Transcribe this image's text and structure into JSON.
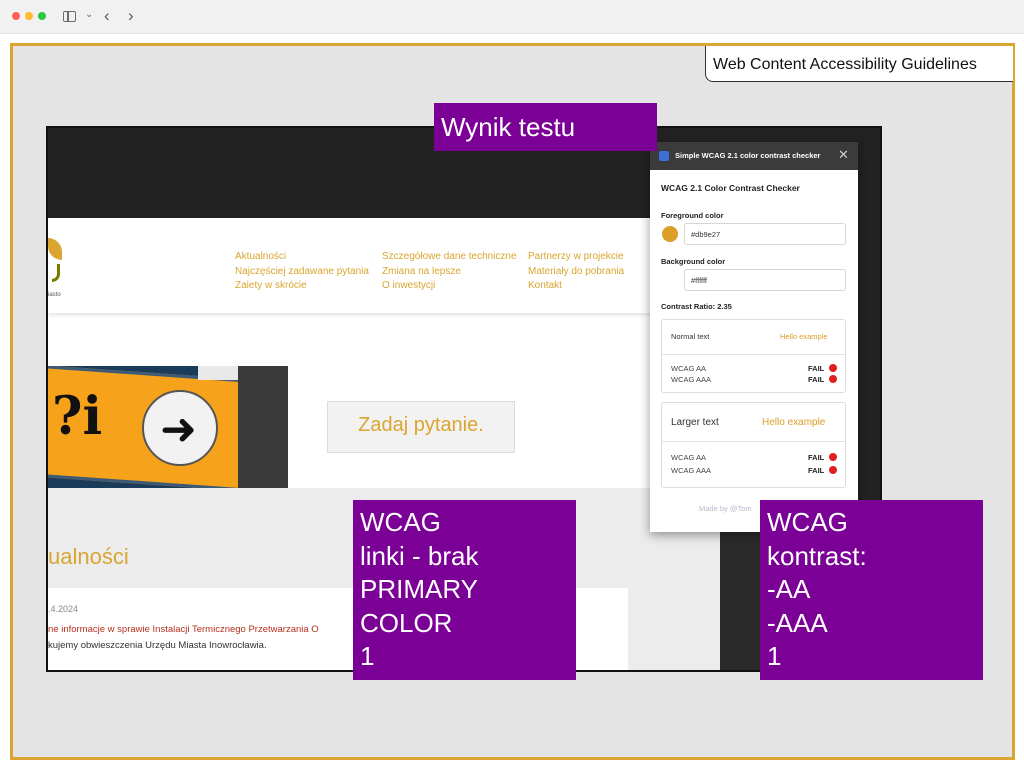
{
  "browser": {
    "back_glyph": "‹",
    "forward_glyph": "›",
    "icons": [
      "sidebar-toggle-icon",
      "chevron-down-icon",
      "back-arrow-icon",
      "forward-arrow-icon"
    ]
  },
  "slide": {
    "title_tag": "Web Content Accessibility Guidelines",
    "frame_color": "#daa530",
    "callout_color": "#7b0096",
    "callouts": {
      "result": "Wynik testu",
      "links": "WCAG\nlinki - brak\nPRIMARY\nCOLOR\n1",
      "contrast": "WCAG\nkontrast:\n-AA\n-AAA\n1"
    }
  },
  "website": {
    "logo_text": "iasto",
    "nav": {
      "col1": [
        "Aktualności",
        "Najczęściej zadawane pytania",
        "Zaiety w skrócie"
      ],
      "col2": [
        "Szczegółowe dane techniczne",
        "Zmiana na lepsze",
        "O inwestycji"
      ],
      "col3": [
        "Partnerzy w projekcie",
        "Materiały do pobrania",
        "Kontakt"
      ]
    },
    "hero_glyphs": "?i",
    "hero_arrow": "➜",
    "ask_button": "Zadaj pytanie.",
    "news_heading": "ualności",
    "news": {
      "date": ".4.2024",
      "title": "ne informacje w sprawie Instalacji Termicznego Przetwarzania O",
      "description": "kujemy obwieszczenia Urzędu Miasta Inowrocławia."
    }
  },
  "checker": {
    "header_title": "Simple WCAG 2.1 color contrast checker",
    "close_glyph": "✕",
    "title": "WCAG 2.1 Color Contrast Checker",
    "foreground_label": "Foreground color",
    "foreground_value": "#db9e27",
    "background_label": "Background color",
    "background_value": "#ffffff",
    "contrast_ratio": "Contrast Ratio: 2.35",
    "normal": {
      "label": "Normal text",
      "example": "Hello example",
      "rows": [
        {
          "level": "WCAG AA",
          "result": "FAIL"
        },
        {
          "level": "WCAG AAA",
          "result": "FAIL"
        }
      ]
    },
    "large": {
      "label": "Larger text",
      "example": "Hello example",
      "rows": [
        {
          "level": "WCAG AA",
          "result": "FAIL"
        },
        {
          "level": "WCAG AAA",
          "result": "FAIL"
        }
      ]
    },
    "made_by": "Made by @Tom",
    "fail_color": "#e02020"
  }
}
